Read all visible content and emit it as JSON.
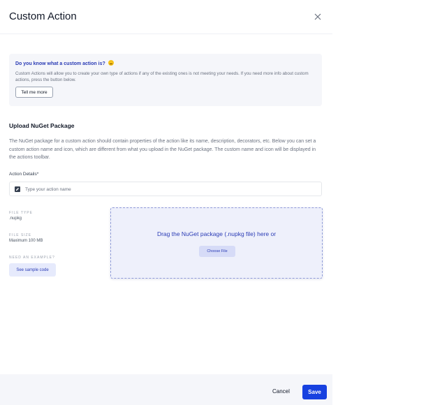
{
  "header": {
    "title": "Custom Action"
  },
  "info": {
    "question": "Do you know what a custom action is?",
    "text": "Custom Actions will allow you to create your own type of actions if any of the existing ones is not meeting your needs. If you need more info about custom actions, press the button below.",
    "button_label": "Tell me more"
  },
  "upload": {
    "heading": "Upload NuGet Package",
    "description": "The NuGet package for a custom action should contain properties of the action like its name, description, decorators, etc. Below you can set a custom action name and icon, which are different from what you upload in the NuGet package. The custom name and icon will be displayed in the actions toolbar.",
    "details_label": "Action Details*",
    "name_placeholder": "Type your action name"
  },
  "file_info": {
    "type_label": "FILE TYPE",
    "type_value": ".nupkg",
    "size_label": "FILE SIZE",
    "size_value": "Maximum 100 MB",
    "example_label": "NEED AN EXAMPLE?",
    "sample_button": "See sample code"
  },
  "dropzone": {
    "text": "Drag the NuGet package (.nupkg file) here or",
    "choose_button": "Choose File"
  },
  "footer": {
    "cancel_label": "Cancel",
    "save_label": "Save"
  },
  "colors": {
    "accent": "#1741e0",
    "link": "#2a3bb5",
    "dropzone_bg": "#eef0fb"
  }
}
